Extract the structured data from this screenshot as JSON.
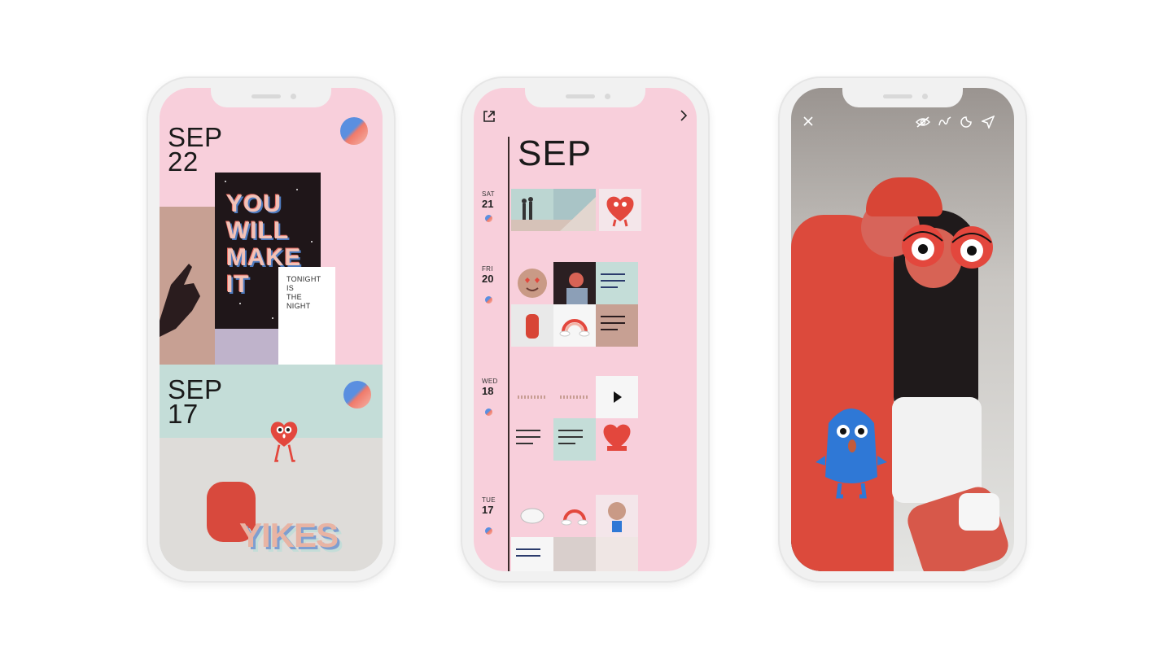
{
  "phone1": {
    "sections": [
      {
        "month": "SEP",
        "day": "22"
      },
      {
        "month": "SEP",
        "day": "17"
      }
    ],
    "poster_text": [
      "YOU",
      "WILL",
      "MAKE",
      "IT"
    ],
    "tonight_text": [
      "TONIGHT",
      "IS",
      "THE",
      "NIGHT"
    ],
    "sticker_text": "YIKES"
  },
  "phone2": {
    "month_heading": "SEP",
    "icons": {
      "share": "share-out-icon",
      "next": "chevron-right-icon"
    },
    "days": [
      {
        "dow": "SAT",
        "dom": "21"
      },
      {
        "dow": "FRI",
        "dom": "20"
      },
      {
        "dow": "WED",
        "dom": "18"
      },
      {
        "dow": "TUE",
        "dom": "17"
      }
    ]
  },
  "phone3": {
    "icons": [
      "close-icon",
      "hide-eye-icon",
      "squiggle-icon",
      "sticker-icon",
      "send-icon"
    ]
  },
  "colors": {
    "pink": "#f8cfdb",
    "mint": "#c4ddd8",
    "red": "#dc4a3c",
    "blue": "#2f78d6"
  }
}
